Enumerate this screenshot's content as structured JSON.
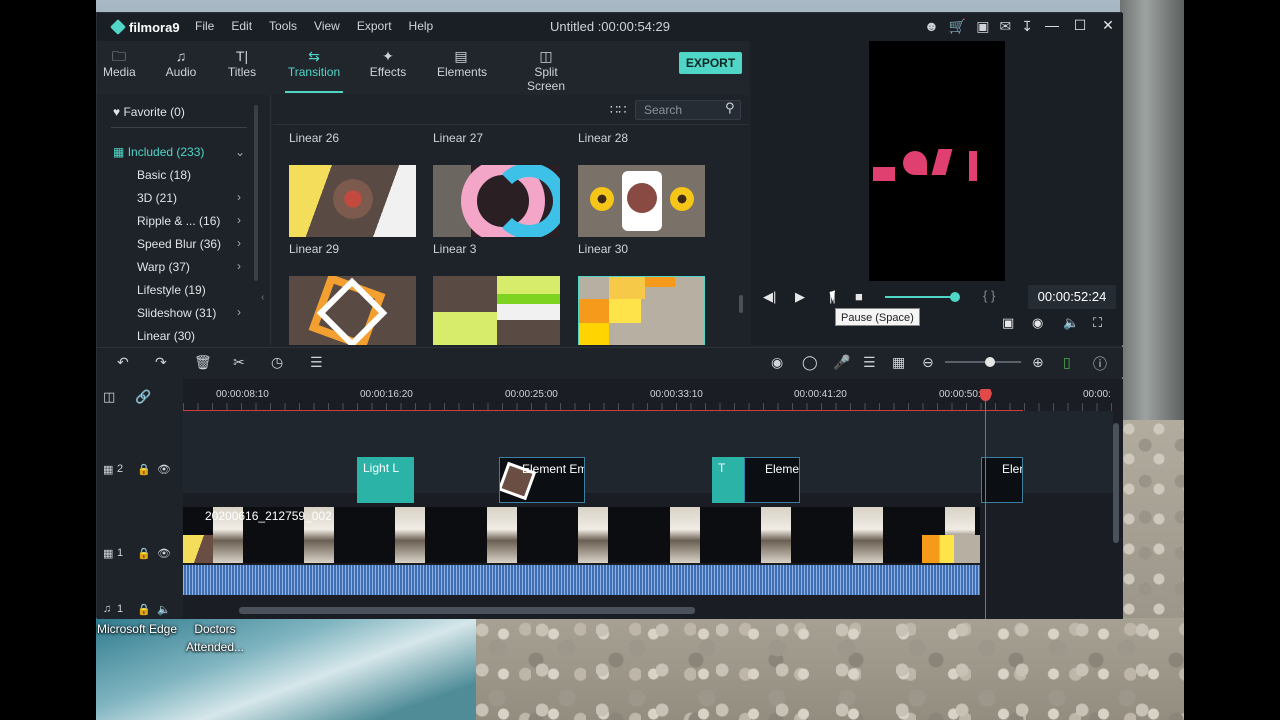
{
  "window": {
    "brand": "filmora9",
    "title": "Untitled :00:00:54:29",
    "menu": [
      "File",
      "Edit",
      "Tools",
      "View",
      "Export",
      "Help"
    ]
  },
  "tabs": [
    {
      "label": "Media",
      "icon": "folder-icon"
    },
    {
      "label": "Audio",
      "icon": "music-note-icon"
    },
    {
      "label": "Titles",
      "icon": "text-icon"
    },
    {
      "label": "Transition",
      "icon": "transition-icon",
      "active": true
    },
    {
      "label": "Effects",
      "icon": "effects-icon"
    },
    {
      "label": "Elements",
      "icon": "image-icon"
    },
    {
      "label": "Split Screen",
      "icon": "split-screen-icon"
    }
  ],
  "export_label": "EXPORT",
  "categories": {
    "favorite": "Favorite (0)",
    "included": "Included (233)",
    "items": [
      {
        "label": "Basic (18)",
        "has_children": false
      },
      {
        "label": "3D (21)",
        "has_children": true
      },
      {
        "label": "Ripple & ... (16)",
        "has_children": true
      },
      {
        "label": "Speed Blur (36)",
        "has_children": true
      },
      {
        "label": "Warp (37)",
        "has_children": true
      },
      {
        "label": "Lifestyle (19)",
        "has_children": false
      },
      {
        "label": "Slideshow (31)",
        "has_children": true
      },
      {
        "label": "Linear (30)",
        "has_children": false
      }
    ]
  },
  "search": {
    "placeholder": "Search"
  },
  "grid": {
    "row_labels_top": [
      "Linear 26",
      "Linear 27",
      "Linear 28"
    ],
    "row_labels_mid": [
      "Linear 29",
      "Linear 3",
      "Linear 30"
    ]
  },
  "preview": {
    "timecode": "00:00:52:24",
    "tooltip": "Pause (Space)",
    "progress": 0.88,
    "markers": "{   }"
  },
  "timeline": {
    "ruler_labels": [
      "00:00:08:10",
      "00:00:16:20",
      "00:00:25:00",
      "00:00:33:10",
      "00:00:41:20",
      "00:00:50:00",
      "00:00:"
    ],
    "tracks": [
      {
        "id": "2",
        "type": "video"
      },
      {
        "id": "1",
        "type": "video"
      },
      {
        "id": "1",
        "type": "audio"
      }
    ],
    "clips_track2": [
      "Light L",
      "Element Em",
      "T",
      "Eleme",
      "Eler"
    ],
    "video_clip_name": "20200616_212759_002",
    "zoom_level": 0.55
  },
  "desktop_icons": [
    {
      "label": "Microsoft Edge"
    },
    {
      "label": "Doctors Attended..."
    }
  ],
  "colors": {
    "accent": "#4fd6c6",
    "playhead": "#e24a4a",
    "audio": "#3f6fb0",
    "element_clip": "#2bb3a8"
  }
}
